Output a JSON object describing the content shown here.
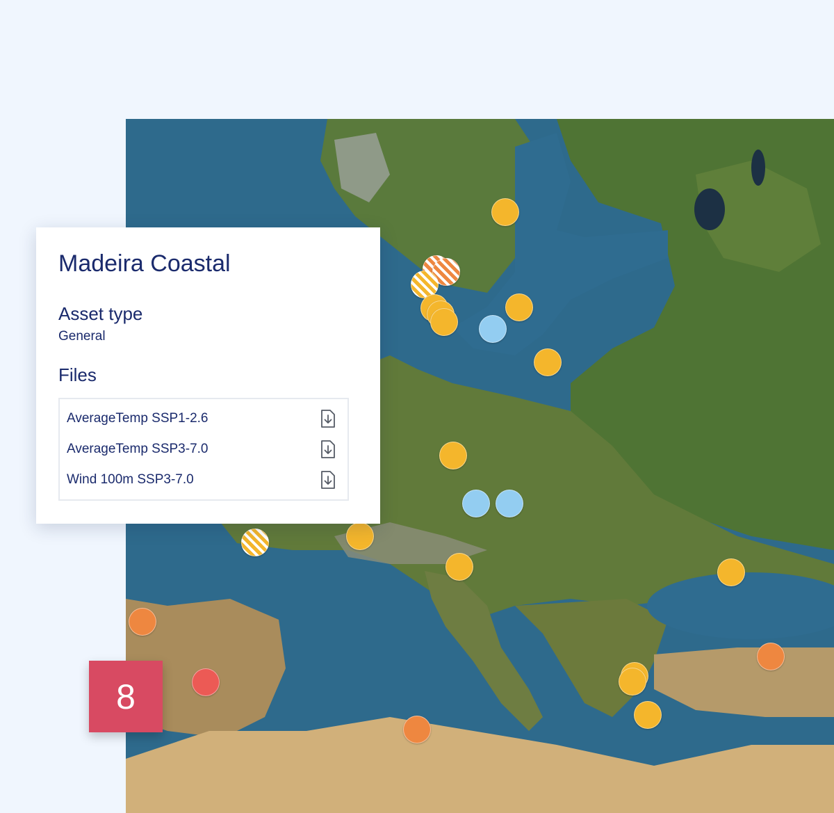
{
  "card": {
    "title": "Madeira Coastal",
    "asset_type_label": "Asset type",
    "asset_type_value": "General",
    "files_label": "Files",
    "files": [
      {
        "name": "AverageTemp SSP1-2.6",
        "icon": "download-file-icon"
      },
      {
        "name": "AverageTemp SSP3-7.0",
        "icon": "download-file-icon"
      },
      {
        "name": "Wind 100m SSP3-7.0",
        "icon": "download-file-icon"
      }
    ]
  },
  "step_badge": "8",
  "colors": {
    "page_background": "#f0f6fe",
    "title_text": "#1a2a6c",
    "badge": "#d84a62",
    "marker_yellow": "#f4b62c",
    "marker_blue": "#93cdf1",
    "marker_orange": "#ee8740",
    "marker_red": "#ec5a55"
  },
  "map": {
    "markers": [
      {
        "type": "yellow"
      },
      {
        "type": "orange-striped"
      },
      {
        "type": "orange-striped"
      },
      {
        "type": "yellow-striped"
      },
      {
        "type": "yellow"
      },
      {
        "type": "yellow"
      },
      {
        "type": "yellow"
      },
      {
        "type": "yellow"
      },
      {
        "type": "blue"
      },
      {
        "type": "yellow"
      },
      {
        "type": "yellow"
      },
      {
        "type": "blue"
      },
      {
        "type": "blue"
      },
      {
        "type": "yellow-striped"
      },
      {
        "type": "yellow"
      },
      {
        "type": "yellow"
      },
      {
        "type": "yellow"
      },
      {
        "type": "orange"
      },
      {
        "type": "orange"
      },
      {
        "type": "red"
      },
      {
        "type": "yellow"
      },
      {
        "type": "yellow"
      },
      {
        "type": "yellow"
      },
      {
        "type": "orange"
      }
    ]
  }
}
